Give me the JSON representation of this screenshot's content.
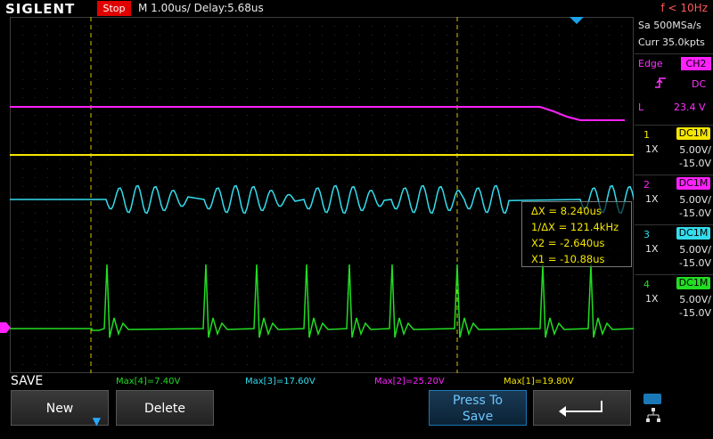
{
  "header": {
    "brand": "SIGLENT",
    "run_state": "Stop",
    "timebase": "M 1.00us/  Delay:5.68us",
    "frequency": "f < 10Hz"
  },
  "acquisition": {
    "sample_rate": "Sa 500MSa/s",
    "memory": "Curr 35.0kpts"
  },
  "trigger": {
    "type": "Edge",
    "source": "CH2",
    "coupling": "DC",
    "level_marker": "L",
    "level": "23.4 V"
  },
  "channels": [
    {
      "num": "1",
      "coupling": "DC1M",
      "probe": "1X",
      "scale": "5.00V/",
      "offset": "-15.0V",
      "color": "#f5e600"
    },
    {
      "num": "2",
      "coupling": "DC1M",
      "probe": "1X",
      "scale": "5.00V/",
      "offset": "-15.0V",
      "color": "#ff22ff"
    },
    {
      "num": "3",
      "coupling": "DC1M",
      "probe": "1X",
      "scale": "5.00V/",
      "offset": "-15.0V",
      "color": "#33ddee"
    },
    {
      "num": "4",
      "coupling": "DC1M",
      "probe": "1X",
      "scale": "5.00V/",
      "offset": "-15.0V",
      "color": "#22dd22"
    }
  ],
  "cursors": {
    "delta_x": "ΔX = 8.240us",
    "inv_delta_x": "1/ΔX = 121.4kHz",
    "x2": "X2 = -2.640us",
    "x1": "X1 = -10.88us"
  },
  "measurements": {
    "m4": "Max[4]=7.40V",
    "m3": "Max[3]=17.60V",
    "m2": "Max[2]=25.20V",
    "m1": "Max[1]=19.80V"
  },
  "menu": {
    "title": "SAVE",
    "new_label": "New",
    "delete_label": "Delete",
    "press_to_save_line1": "Press To",
    "press_to_save_line2": "Save"
  },
  "icons": {
    "return": "return-arrow-icon",
    "usb": "usb-icon",
    "network": "network-icon"
  }
}
